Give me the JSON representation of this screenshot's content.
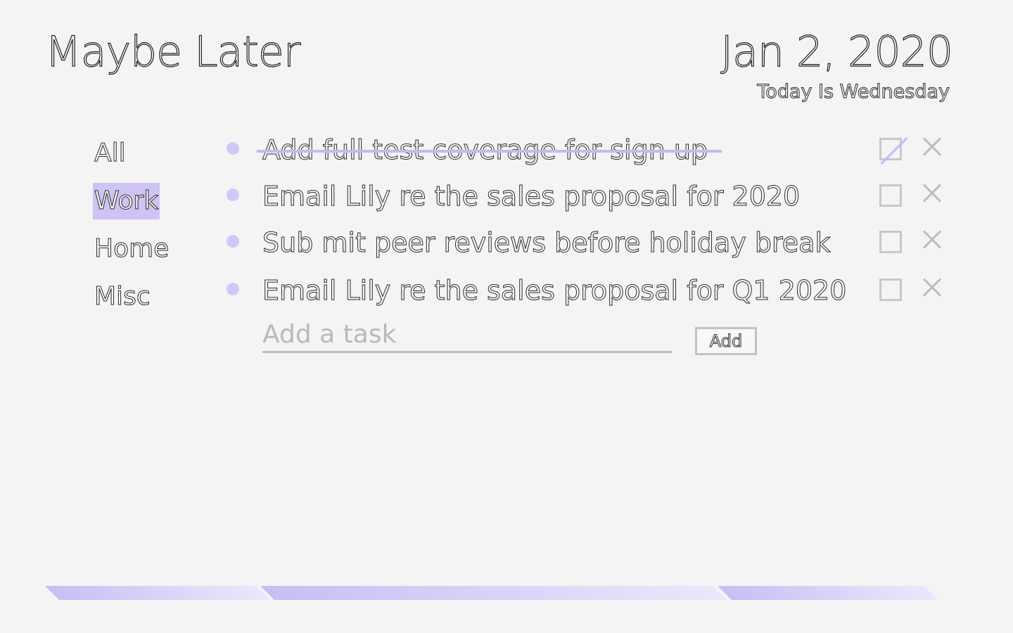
{
  "header": {
    "title": "Maybe Later",
    "date": "Jan 2, 2020",
    "day": "Today Is Wednesday"
  },
  "sidebar": {
    "categories": [
      {
        "label": "All",
        "active": false
      },
      {
        "label": "Work",
        "active": true
      },
      {
        "label": "Home",
        "active": false
      },
      {
        "label": "Misc",
        "active": false
      }
    ]
  },
  "tasks": [
    {
      "text": "Add full test coverage for sign up",
      "done": true
    },
    {
      "text": "Email Lily re the sales proposal for 2020",
      "done": false
    },
    {
      "text": "Sub mit peer reviews before holiday break",
      "done": false
    },
    {
      "text": "Email Lily re the sales proposal for Q1 2020",
      "done": false
    }
  ],
  "add_task": {
    "placeholder": "Add a task",
    "value": "",
    "button_label": "Add"
  },
  "colors": {
    "accent": "#cfc3f4",
    "bullet": "#d3c8f5",
    "background": "#f4f4f4",
    "control_gray": "#c2c2c2"
  },
  "icons": {
    "bullet": "dot-icon",
    "checkbox": "checkbox-icon",
    "delete": "close-icon"
  }
}
